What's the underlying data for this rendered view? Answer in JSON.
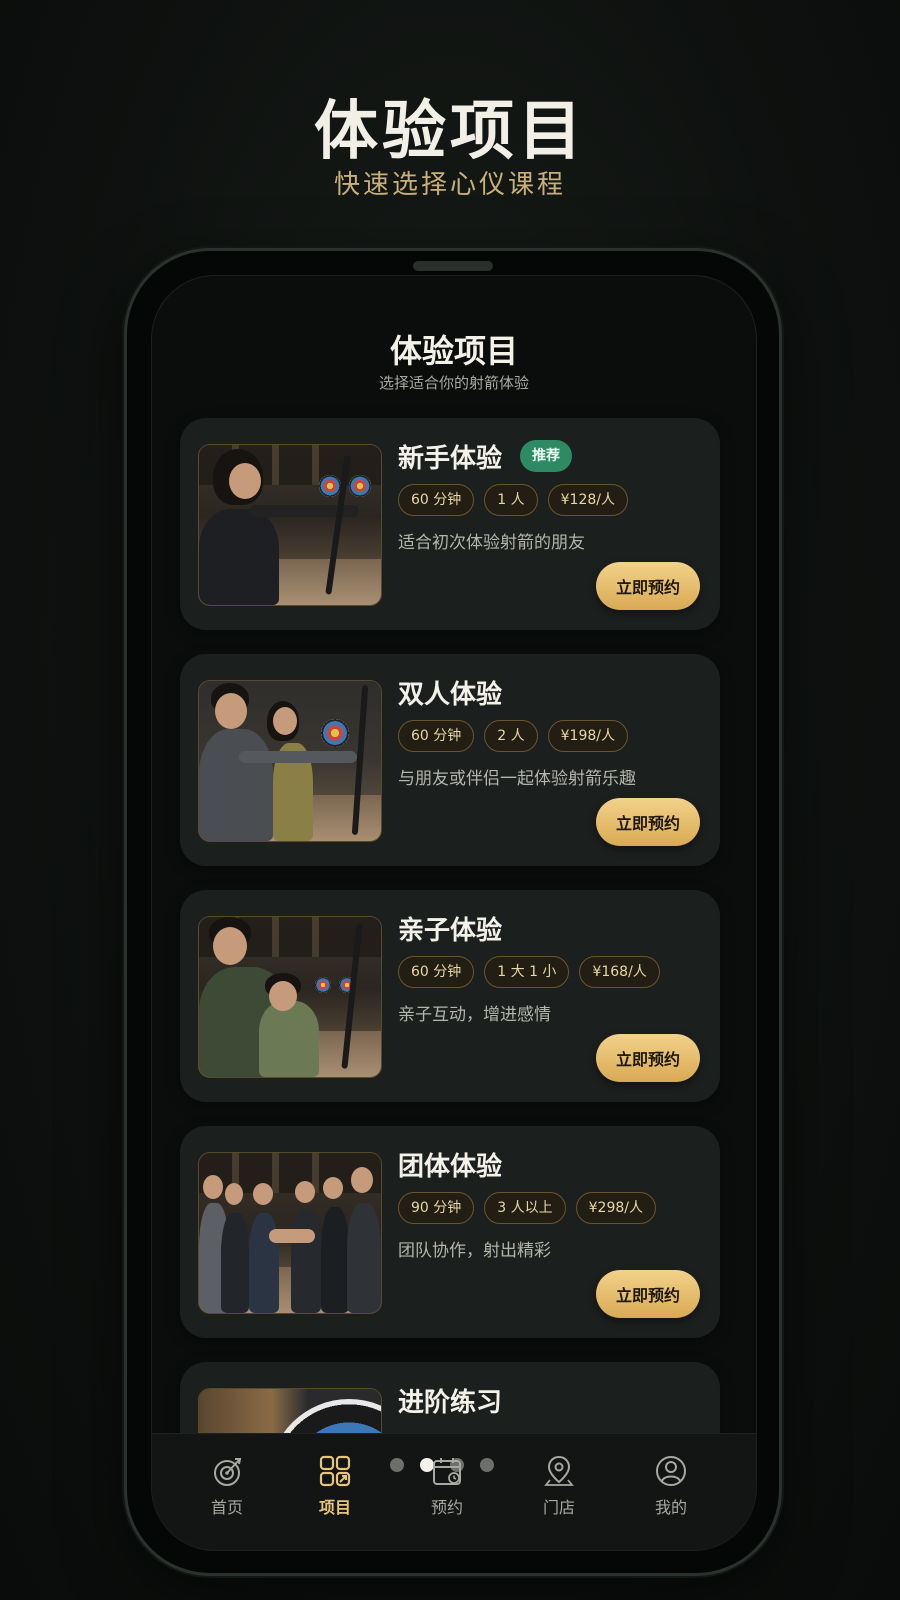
{
  "hero": {
    "title": "体验项目",
    "subtitle": "快速选择心仪课程"
  },
  "screen": {
    "title": "体验项目",
    "subtitle": "选择适合你的射箭体验"
  },
  "cards": [
    {
      "title": "新手体验",
      "badge": "推荐",
      "tags": [
        "60 分钟",
        "1 人",
        "¥128/人"
      ],
      "desc": "适合初次体验射箭的朋友",
      "button": "立即预约"
    },
    {
      "title": "双人体验",
      "tags": [
        "60 分钟",
        "2 人",
        "¥198/人"
      ],
      "desc": "与朋友或伴侣一起体验射箭乐趣",
      "button": "立即预约"
    },
    {
      "title": "亲子体验",
      "tags": [
        "60 分钟",
        "1 大 1 小",
        "¥168/人"
      ],
      "desc": "亲子互动，增进感情",
      "button": "立即预约"
    },
    {
      "title": "团体体验",
      "tags": [
        "90 分钟",
        "3 人以上",
        "¥298/人"
      ],
      "desc": "团队协作，射出精彩",
      "button": "立即预约"
    },
    {
      "title": "进阶练习"
    }
  ],
  "tabbar": {
    "items": [
      {
        "label": "首页",
        "icon": "target-icon"
      },
      {
        "label": "项目",
        "icon": "grid-icon",
        "active": true
      },
      {
        "label": "预约",
        "icon": "calendar-icon"
      },
      {
        "label": "门店",
        "icon": "location-icon"
      },
      {
        "label": "我的",
        "icon": "user-icon"
      }
    ]
  },
  "pager": {
    "count": 4,
    "active_index": 1
  },
  "colors": {
    "accent": "#e6c67a",
    "badge": "#2e8a63",
    "background": "#0b0d0c",
    "card": "#1b1f1d"
  }
}
